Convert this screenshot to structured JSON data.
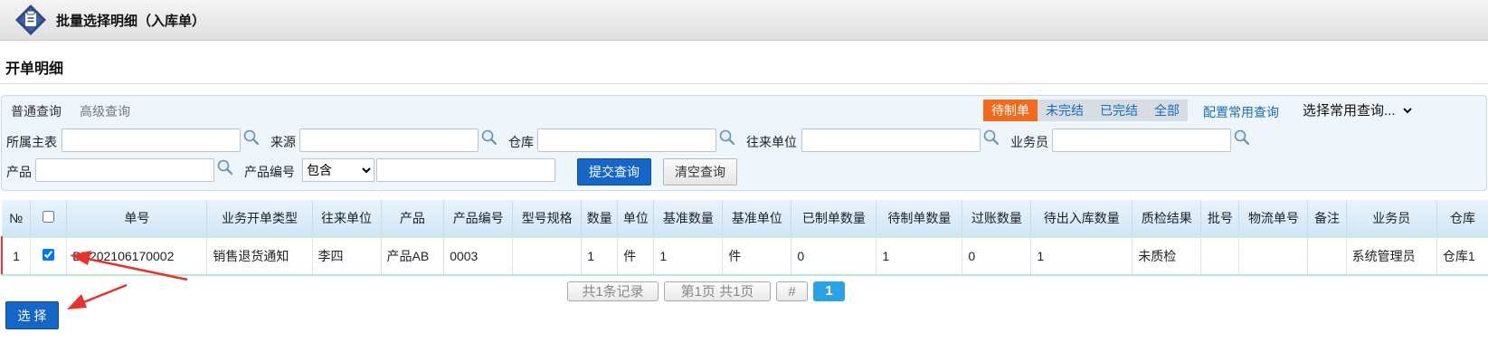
{
  "window": {
    "title": "批量选择明细（入库单）"
  },
  "section": {
    "title": "开单明细"
  },
  "query": {
    "tabs": [
      "普通查询",
      "高级查询"
    ],
    "status_filters": [
      "待制单",
      "未完结",
      "已完结",
      "全部"
    ],
    "active_status": "待制单",
    "config_link": "配置常用查询",
    "common_query_placeholder": "选择常用查询...",
    "fields": {
      "main_table": "所属主表",
      "source": "来源",
      "warehouse": "仓库",
      "partner": "往来单位",
      "salesperson": "业务员",
      "product": "产品",
      "product_code": "产品编号"
    },
    "match_mode": "包含",
    "match_options": [
      "包含"
    ],
    "submit_label": "提交查询",
    "clear_label": "清空查询"
  },
  "table": {
    "columns": [
      "№",
      "",
      "单号",
      "业务开单类型",
      "往来单位",
      "产品",
      "产品编号",
      "型号规格",
      "数量",
      "单位",
      "基准数量",
      "基准单位",
      "已制单数量",
      "待制单数量",
      "过账数量",
      "待出入库数量",
      "质检结果",
      "批号",
      "物流单号",
      "备注",
      "业务员",
      "仓库"
    ],
    "rows": [
      {
        "no": "1",
        "checked": true,
        "order_no": "BB202106170002",
        "business_type": "销售退货通知",
        "partner": "李四",
        "product": "产品AB",
        "product_code": "0003",
        "spec": "",
        "quantity": "1",
        "unit": "件",
        "base_quantity": "1",
        "base_unit": "件",
        "made_quantity": "0",
        "pending_quantity": "1",
        "posted_quantity": "0",
        "pending_io_quantity": "1",
        "qc_result": "未质检",
        "batch_no": "",
        "logistics_no": "",
        "remark": "",
        "salesperson": "系统管理员",
        "warehouse": "仓库1"
      }
    ]
  },
  "pager": {
    "total": "共1条记录",
    "pages": "第1页 共1页",
    "hash": "#",
    "current": "1"
  },
  "select_button": "选 择",
  "colors": {
    "accent": "#1466c8",
    "active_status": "#f26b1d",
    "annotation_arrow": "#e8322a"
  }
}
